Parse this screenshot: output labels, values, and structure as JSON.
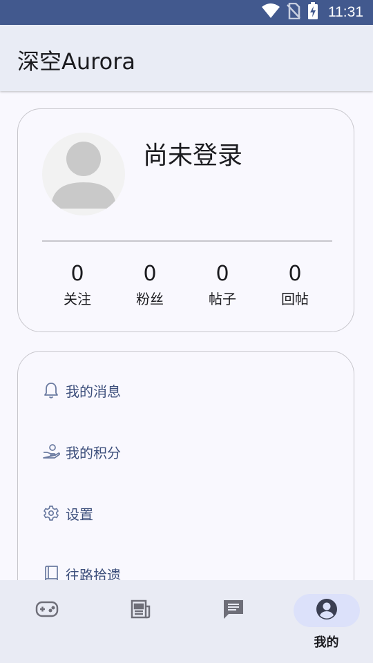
{
  "status_bar": {
    "time": "11:31",
    "icons": [
      "wifi-icon",
      "no-sim-icon",
      "battery-charging-icon"
    ]
  },
  "app_bar": {
    "title": "深空Aurora"
  },
  "profile": {
    "username": "尚未登录",
    "stats": [
      {
        "value": "0",
        "label": "关注"
      },
      {
        "value": "0",
        "label": "粉丝"
      },
      {
        "value": "0",
        "label": "帖子"
      },
      {
        "value": "0",
        "label": "回帖"
      }
    ]
  },
  "menu": {
    "items": [
      {
        "icon": "bell-icon",
        "label": "我的消息"
      },
      {
        "icon": "points-hand-icon",
        "label": "我的积分"
      },
      {
        "icon": "settings-gear-icon",
        "label": "设置"
      },
      {
        "icon": "book-icon",
        "label": "往路拾遗"
      }
    ]
  },
  "bottom_nav": {
    "items": [
      {
        "icon": "gamepad-icon",
        "label": ""
      },
      {
        "icon": "newspaper-icon",
        "label": ""
      },
      {
        "icon": "chat-icon",
        "label": ""
      },
      {
        "icon": "account-circle-icon",
        "label": "我的",
        "active": true
      }
    ]
  },
  "colors": {
    "status_bar": "#42598e",
    "app_bar": "#e9ecf5",
    "background": "#f9f8fe",
    "menu_text": "#3d4f7c",
    "active_pill": "#dce1fa",
    "nav_background": "#e9ebf4"
  }
}
